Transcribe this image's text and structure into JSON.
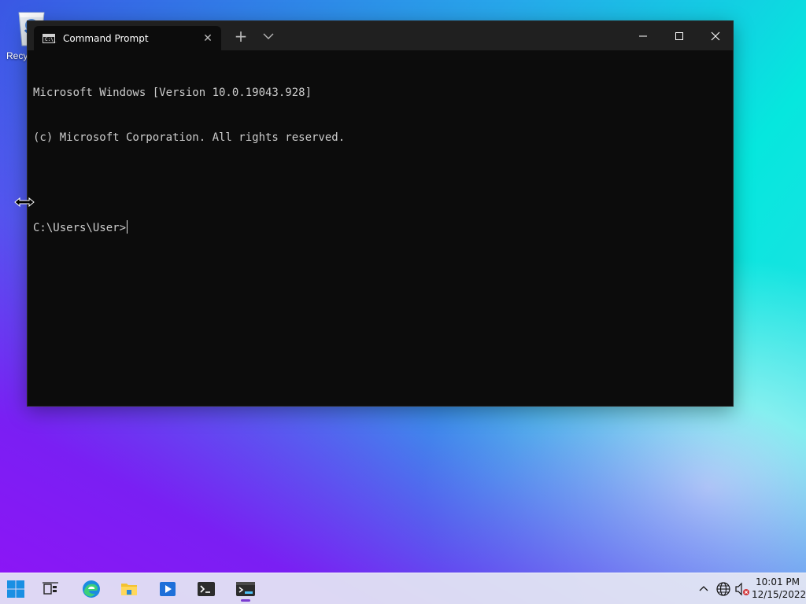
{
  "desktop": {
    "recycle_bin_label": "Recy"
  },
  "window": {
    "tab_title": "Command Prompt",
    "tab_icon_text": "C:\\_",
    "new_tab_symbol": "+",
    "close_tab_symbol": "✕",
    "console_lines": [
      "Microsoft Windows [Version 10.0.19043.928]",
      "(c) Microsoft Corporation. All rights reserved.",
      "",
      "C:\\Users\\User>"
    ],
    "background_color": "#0c0c0c",
    "titlebar_color": "#202020"
  },
  "taskbar": {
    "items": [
      {
        "name": "Start",
        "icon": "windows-logo-icon"
      },
      {
        "name": "Task View",
        "icon": "task-view-icon"
      },
      {
        "name": "Microsoft Edge",
        "icon": "edge-icon"
      },
      {
        "name": "File Explorer",
        "icon": "folder-icon"
      },
      {
        "name": "Media Player",
        "icon": "media-player-icon"
      },
      {
        "name": "Terminal",
        "icon": "terminal-icon"
      },
      {
        "name": "Windows Terminal",
        "icon": "windows-terminal-icon",
        "active": true
      }
    ],
    "clock": {
      "time": "10:01 PM",
      "date": "12/15/2022"
    },
    "accent_color": "#7a3cd0"
  }
}
